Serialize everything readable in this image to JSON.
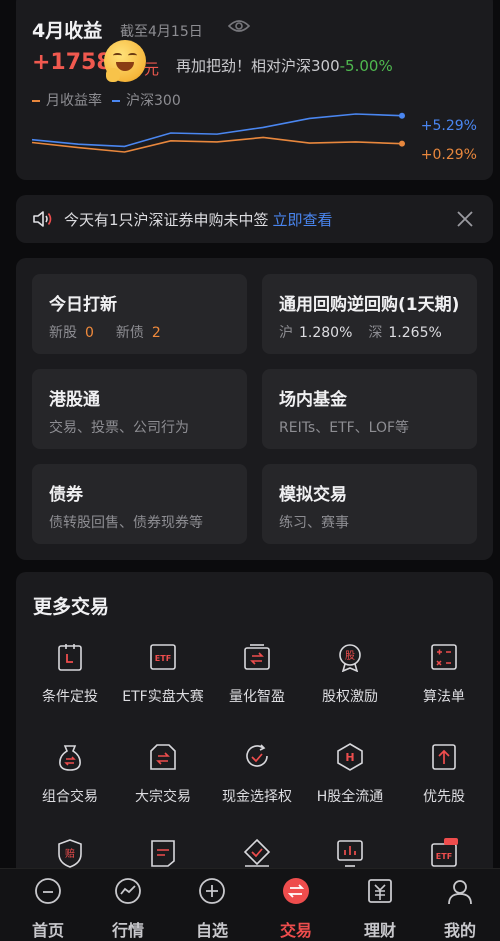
{
  "earnings": {
    "title": "4月收益",
    "as_of": "截至4月15日",
    "amount": "+1758",
    "unit": "元",
    "message": "再加把劲！相对沪深300",
    "relative_pct": "-5.00%",
    "legend": [
      {
        "label": "月收益率",
        "color": "#e8873d"
      },
      {
        "label": "沪深300",
        "color": "#4a86f0"
      }
    ],
    "csi300_end": "+5.29%",
    "monthly_end": "+0.29%"
  },
  "chart_data": {
    "type": "line",
    "series": [
      {
        "name": "沪深300",
        "color": "#4a86f0",
        "values": [
          1.0,
          0.2,
          -0.2,
          2.2,
          2.0,
          3.2,
          4.8,
          5.6,
          5.29
        ]
      },
      {
        "name": "月收益率",
        "color": "#e8873d",
        "values": [
          0.5,
          -0.4,
          -1.2,
          0.8,
          0.6,
          1.4,
          0.4,
          0.6,
          0.29
        ]
      }
    ]
  },
  "notice": {
    "text": "今天有1只沪深证券申购未中签",
    "link": "立即查看"
  },
  "tiles": [
    {
      "title": "今日打新",
      "a_label": "新股",
      "a_val": "0",
      "b_label": "新债",
      "b_val": "2"
    },
    {
      "title": "通用回购逆回购(1天期)",
      "a_label": "沪",
      "a_val": "1.280%",
      "b_label": "深",
      "b_val": "1.265%"
    },
    {
      "title": "港股通",
      "sub": "交易、投票、公司行为"
    },
    {
      "title": "场内基金",
      "sub": "REITs、ETF、LOF等"
    },
    {
      "title": "债券",
      "sub": "债转股回售、债券现券等"
    },
    {
      "title": "模拟交易",
      "sub": "练习、赛事"
    }
  ],
  "more": {
    "title": "更多交易",
    "items": [
      {
        "label": "条件定投",
        "icon": "conditional-invest-icon"
      },
      {
        "label": "ETF实盘大赛",
        "icon": "etf-contest-icon"
      },
      {
        "label": "量化智盈",
        "icon": "quant-icon"
      },
      {
        "label": "股权激励",
        "icon": "equity-incentive-icon"
      },
      {
        "label": "算法单",
        "icon": "algorithm-order-icon"
      },
      {
        "label": "组合交易",
        "icon": "portfolio-trade-icon"
      },
      {
        "label": "大宗交易",
        "icon": "block-trade-icon"
      },
      {
        "label": "现金选择权",
        "icon": "cash-option-icon"
      },
      {
        "label": "H股全流通",
        "icon": "h-share-icon"
      },
      {
        "label": "优先股",
        "icon": "preferred-stock-icon"
      }
    ]
  },
  "nav": [
    {
      "label": "首页",
      "icon": "home-icon"
    },
    {
      "label": "行情",
      "icon": "market-icon"
    },
    {
      "label": "自选",
      "icon": "watchlist-icon"
    },
    {
      "label": "交易",
      "icon": "trade-icon",
      "active": true
    },
    {
      "label": "理财",
      "icon": "wealth-icon"
    },
    {
      "label": "我的",
      "icon": "profile-icon"
    }
  ]
}
